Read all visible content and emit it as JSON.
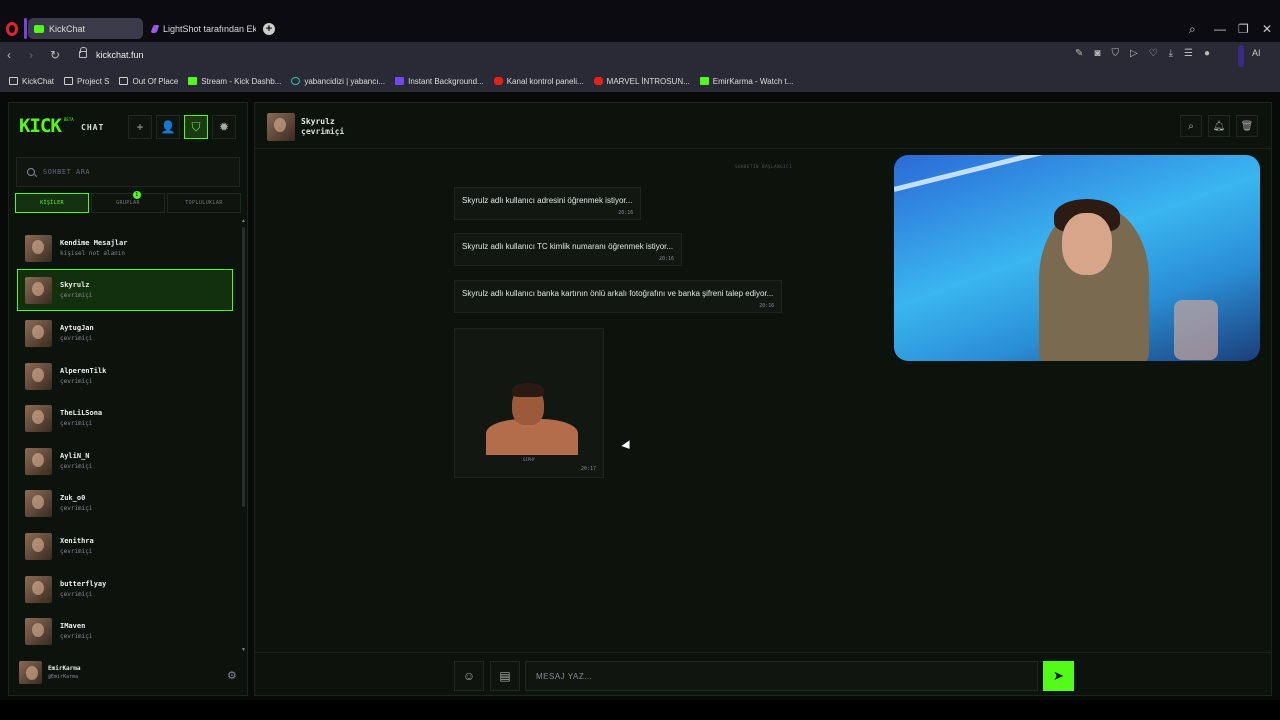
{
  "browser": {
    "tabs": [
      {
        "label": "KickChat",
        "active": true
      },
      {
        "label": "LightShot tarafından Ekran",
        "active": false
      }
    ],
    "url": "kickchat.fun",
    "ai_label": "AI",
    "bookmarks": [
      {
        "label": "KickChat",
        "icon": "folder-icon"
      },
      {
        "label": "Project S",
        "icon": "folder-icon"
      },
      {
        "label": "Out Of Place",
        "icon": "folder-icon"
      },
      {
        "label": "Stream - Kick Dashb...",
        "icon": "kick-icon"
      },
      {
        "label": "yabancidizi | yabancı...",
        "icon": "globe-icon"
      },
      {
        "label": "Instant Background...",
        "icon": "p-icon"
      },
      {
        "label": "Kanal kontrol paneli...",
        "icon": "youtube-icon"
      },
      {
        "label": "MARVEL İNTROSUN...",
        "icon": "youtube-icon"
      },
      {
        "label": "EmirKarma - Watch t...",
        "icon": "kick-icon"
      }
    ]
  },
  "sidebar": {
    "logo": "KICK",
    "logo_beta": "BETA",
    "logo_chat": "CHAT",
    "search_placeholder": "SOHBET ARA",
    "segments": [
      {
        "label": "KİŞİLER",
        "active": true
      },
      {
        "label": "GRUPLAR",
        "active": false,
        "badge": "1"
      },
      {
        "label": "TOPLULUKLAR",
        "active": false
      }
    ],
    "contacts": [
      {
        "name": "Kendime Mesajlar",
        "status": "kişisel not alanın",
        "selected": false
      },
      {
        "name": "Skyrulz",
        "status": "çevrimiçi",
        "selected": true
      },
      {
        "name": "AytugJan",
        "status": "çevrimiçi",
        "selected": false
      },
      {
        "name": "AlperenTilk",
        "status": "çevrimiçi",
        "selected": false
      },
      {
        "name": "TheLiLSona",
        "status": "çevrimiçi",
        "selected": false
      },
      {
        "name": "AyliN_N",
        "status": "çevrimiçi",
        "selected": false
      },
      {
        "name": "Zuk_o0",
        "status": "çevrimiçi",
        "selected": false
      },
      {
        "name": "Xenithra",
        "status": "çevrimiçi",
        "selected": false
      },
      {
        "name": "butterflyay",
        "status": "çevrimiçi",
        "selected": false
      },
      {
        "name": "IMaven",
        "status": "çevrimiçi",
        "selected": false
      }
    ],
    "me": {
      "name": "EmirKarma",
      "handle": "@EmirKarma"
    }
  },
  "chat": {
    "contact_name": "Skyrulz",
    "contact_status": "çevrimiçi",
    "start_label": "SOHBETİN BAŞLANGICI",
    "messages": [
      {
        "text": "Skyrulz adlı kullanıcı adresini öğrenmek istiyor...",
        "time": "20:16"
      },
      {
        "text": "Skyrulz adlı kullanıcı TC kimlik numaranı öğrenmek istiyor...",
        "time": "20:16"
      },
      {
        "text": "Skyrulz adlı kullanıcı banka kartının önlü arkalı fotoğrafını ve banka şifreni talep ediyor...",
        "time": "20:16"
      }
    ],
    "gif": {
      "label": "GIPHY",
      "time": "20:17"
    },
    "composer_placeholder": "MESAJ YAZ..."
  },
  "colors": {
    "accent": "#53fc18",
    "background": "#0c120c"
  }
}
